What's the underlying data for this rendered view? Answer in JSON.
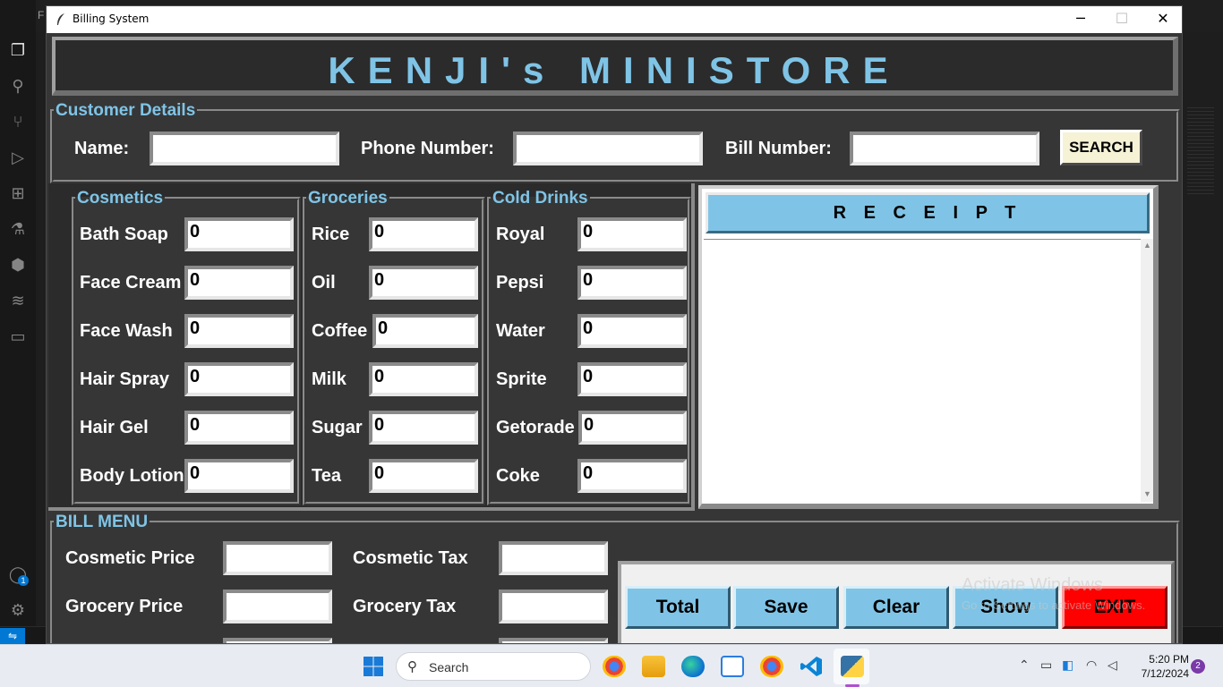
{
  "vscode": {
    "title_fragment": "F",
    "account_badge": "1"
  },
  "window": {
    "title": "Billing System",
    "minimize": "─",
    "maximize": "☐",
    "close": "✕"
  },
  "header": {
    "title": "KENJI's MINISTORE"
  },
  "customer": {
    "legend": "Customer Details",
    "name_label": "Name:",
    "name_value": "",
    "phone_label": "Phone Number:",
    "phone_value": "",
    "bill_label": "Bill Number:",
    "bill_value": "",
    "search_label": "SEARCH"
  },
  "cosmetics": {
    "legend": "Cosmetics",
    "items": [
      {
        "label": "Bath Soap",
        "value": "0"
      },
      {
        "label": "Face Cream",
        "value": "0"
      },
      {
        "label": "Face Wash",
        "value": "0"
      },
      {
        "label": "Hair Spray",
        "value": "0"
      },
      {
        "label": "Hair Gel",
        "value": "0"
      },
      {
        "label": "Body Lotion",
        "value": "0"
      }
    ]
  },
  "groceries": {
    "legend": "Groceries",
    "items": [
      {
        "label": "Rice",
        "value": "0"
      },
      {
        "label": "Oil",
        "value": "0"
      },
      {
        "label": "Coffee",
        "value": "0"
      },
      {
        "label": "Milk",
        "value": "0"
      },
      {
        "label": "Sugar",
        "value": "0"
      },
      {
        "label": "Tea",
        "value": "0"
      }
    ]
  },
  "drinks": {
    "legend": "Cold Drinks",
    "items": [
      {
        "label": "Royal",
        "value": "0"
      },
      {
        "label": "Pepsi",
        "value": "0"
      },
      {
        "label": "Water",
        "value": "0"
      },
      {
        "label": "Sprite",
        "value": "0"
      },
      {
        "label": "Getorade",
        "value": "0"
      },
      {
        "label": "Coke",
        "value": "0"
      }
    ]
  },
  "receipt": {
    "title": "R E C E I P T",
    "content": ""
  },
  "bill_menu": {
    "legend": "BILL MENU",
    "cosmetic_price_label": "Cosmetic Price",
    "cosmetic_price_value": "",
    "cosmetic_tax_label": "Cosmetic Tax",
    "cosmetic_tax_value": "",
    "grocery_price_label": "Grocery Price",
    "grocery_price_value": "",
    "grocery_tax_label": "Grocery Tax",
    "grocery_tax_value": ""
  },
  "actions": {
    "total": "Total",
    "save": "Save",
    "clear": "Clear",
    "show": "Show",
    "exit": "EXIT"
  },
  "watermark": {
    "line1": "Activate Windows",
    "line2": "Go to Settings to activate Windows."
  },
  "taskbar": {
    "search_placeholder": "Search",
    "time": "5:20 PM",
    "date": "7/12/2024",
    "notifications": "2"
  },
  "colors": {
    "accent": "#7fc4e6",
    "exit": "#ff0000",
    "panel": "#363636"
  }
}
